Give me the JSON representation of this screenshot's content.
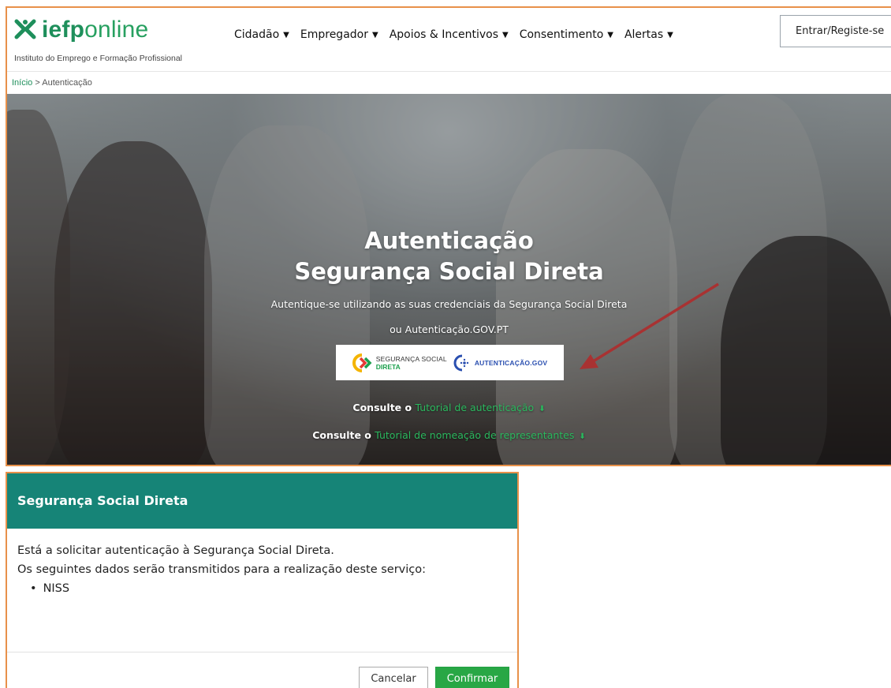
{
  "header": {
    "logo_main": "iefp",
    "logo_suffix": "online",
    "tagline": "Instituto do Emprego e Formação Profissional",
    "nav": [
      {
        "label": "Cidadão"
      },
      {
        "label": "Empregador"
      },
      {
        "label": "Apoios & Incentivos"
      },
      {
        "label": "Consentimento"
      },
      {
        "label": "Alertas"
      }
    ],
    "login_label": "Entrar/Registe-se"
  },
  "breadcrumb": {
    "home": "Início",
    "separator": ">",
    "current": "Autenticação"
  },
  "hero": {
    "title_line1": "Autenticação",
    "title_line2": "Segurança Social Direta",
    "subtitle_line1": "Autentique-se utilizando as suas credenciais da Segurança Social Direta",
    "subtitle_line2": "ou Autenticação.GOV.PT",
    "ssd_label_top": "SEGURANÇA SOCIAL",
    "ssd_label_bottom": "DIRETA",
    "agov_label": "AUTENTICAÇÃO.GOV",
    "consult_prefix": "Consulte o",
    "tutorial_auth": "Tutorial de autenticação",
    "tutorial_rep": "Tutorial de nomeação de representantes"
  },
  "dialog": {
    "title": "Segurança Social Direta",
    "line1": "Está a solicitar autenticação à Segurança Social Direta.",
    "line2": "Os seguintes dados serão transmitidos para a realização deste serviço:",
    "items": [
      "NISS"
    ],
    "cancel_label": "Cancelar",
    "confirm_label": "Confirmar"
  },
  "colors": {
    "brand_green": "#1e8f5b",
    "dialog_header": "#168477",
    "confirm_button": "#28a745",
    "annotation_arrow": "#a83232",
    "frame_border": "#e8914a"
  }
}
